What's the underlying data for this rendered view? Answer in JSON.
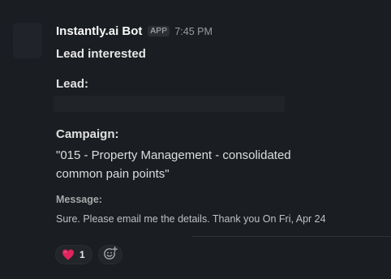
{
  "message": {
    "sender": "Instantly.ai Bot",
    "badge": "APP",
    "timestamp": "7:45 PM",
    "title": "Lead interested",
    "lead_label": "Lead:",
    "campaign_label": "Campaign:",
    "campaign_value": "\"015 - Property Management - consolidated common pain points\"",
    "message_label": "Message:",
    "message_text": "Sure. Please email me the details. Thank you  On Fri, Apr 24"
  },
  "reactions": [
    {
      "emoji_name": "heart-emoji",
      "count": "1"
    }
  ],
  "add_reaction_icon": "add-emoji-icon",
  "colors": {
    "background": "#1a1d21",
    "heart": "#e0245e"
  }
}
